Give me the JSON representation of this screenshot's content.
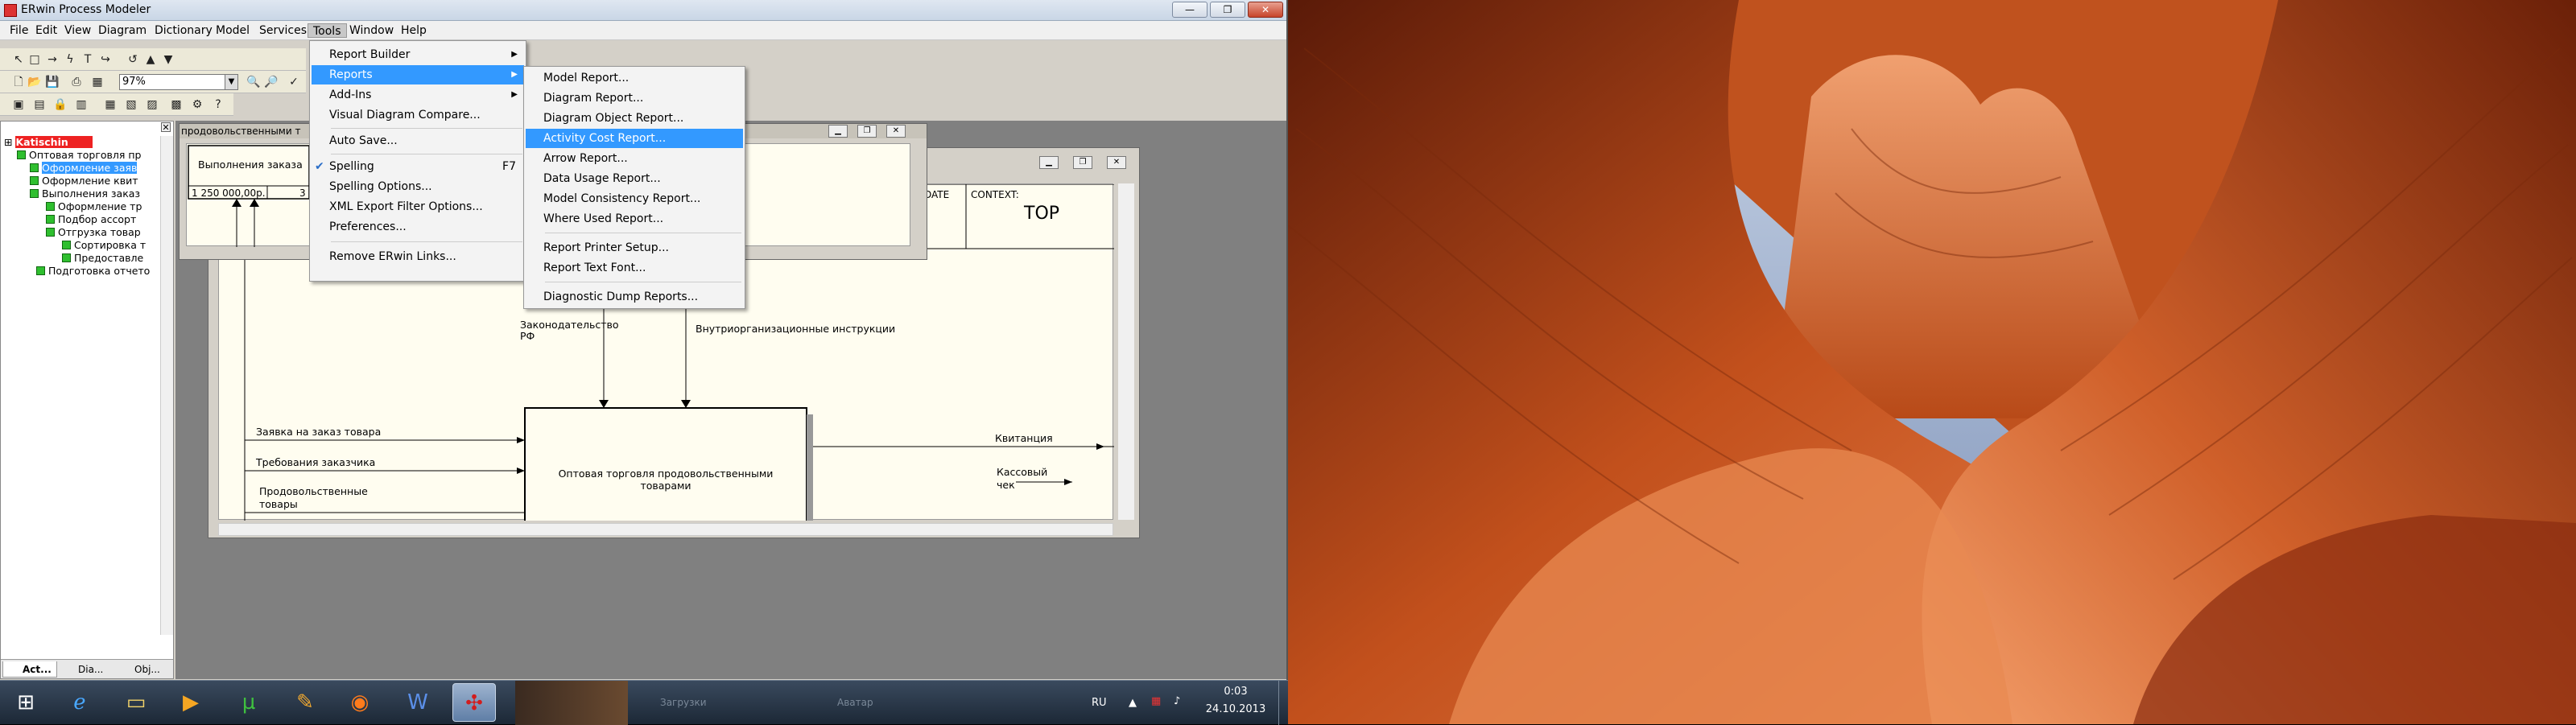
{
  "window": {
    "title": "ERwin Process Modeler",
    "controls": {
      "minimize": "—",
      "maximize": "❐",
      "close": "✕"
    }
  },
  "menubar": [
    "File",
    "Edit",
    "View",
    "Diagram",
    "Dictionary",
    "Model",
    "Services",
    "Tools",
    "Window",
    "Help"
  ],
  "toolbar": {
    "zoom": "97%"
  },
  "explorer": {
    "root": "Katischin",
    "items": [
      {
        "label": "Оптовая торговля пр",
        "indent": 1,
        "sel": false
      },
      {
        "label": "Оформление заяв",
        "indent": 2,
        "sel": true
      },
      {
        "label": "Оформление квит",
        "indent": 2,
        "sel": false
      },
      {
        "label": "Выполнения заказ",
        "indent": 2,
        "sel": false
      },
      {
        "label": "Оформление тр",
        "indent": 3,
        "sel": false
      },
      {
        "label": "Подбор ассорт",
        "indent": 3,
        "sel": false
      },
      {
        "label": "Отгрузка товар",
        "indent": 3,
        "sel": false
      },
      {
        "label": "Сортировка т",
        "indent": 4,
        "sel": false
      },
      {
        "label": "Предоставле",
        "indent": 4,
        "sel": false
      },
      {
        "label": "Подготовка отчето",
        "indent": 2,
        "sel": false
      }
    ],
    "tabs": [
      "Act...",
      "Dia...",
      "Obj..."
    ]
  },
  "front_diagram": {
    "title": "продовольственными т",
    "box_label": "Выполнения заказа",
    "cost": "1 250 000,00р.",
    "box_number": "3"
  },
  "back_diagram": {
    "header": {
      "date": "DATE",
      "context": "CONTEXT:",
      "top": "TOP"
    },
    "main_box": "Оптовая торговля продовольственными товарами",
    "arrows": {
      "law": "Законодательство РФ",
      "internal": "Внутриорганизационные инструкции",
      "order": "Заявка на заказ товара",
      "customer": "Требования заказчика",
      "food": "Продовольственные товары",
      "receipt": "Квитанция",
      "cheque": "Кассовый чек"
    }
  },
  "tools_menu": [
    {
      "label": "Report Builder",
      "sub": true
    },
    {
      "label": "Reports",
      "sub": true,
      "hi": true
    },
    {
      "label": "Add-Ins",
      "sub": true
    },
    {
      "label": "Visual Diagram Compare..."
    },
    {
      "sep": true
    },
    {
      "label": "Auto Save..."
    },
    {
      "sep": true
    },
    {
      "label": "Spelling",
      "shortcut": "F7"
    },
    {
      "label": "Spelling Options..."
    },
    {
      "label": "XML Export Filter Options..."
    },
    {
      "label": "Preferences..."
    },
    {
      "sep": true
    },
    {
      "label": "Remove ERwin Links..."
    }
  ],
  "reports_menu": [
    {
      "label": "Model Report..."
    },
    {
      "label": "Diagram Report..."
    },
    {
      "label": "Diagram Object Report..."
    },
    {
      "label": "Activity Cost Report...",
      "hi": true
    },
    {
      "label": "Arrow Report..."
    },
    {
      "label": "Data Usage Report..."
    },
    {
      "label": "Model Consistency Report..."
    },
    {
      "label": "Where Used Report..."
    },
    {
      "sep": true
    },
    {
      "label": "Report Printer Setup..."
    },
    {
      "label": "Report Text Font..."
    },
    {
      "sep": true
    },
    {
      "label": "Diagnostic Dump Reports..."
    }
  ],
  "taskbar": {
    "tray_lang": "RU",
    "time": "0:03",
    "date": "24.10.2013",
    "ghost_items": [
      "Загрузки",
      "Аватар"
    ]
  },
  "colors": {
    "highlight": "#3399ff",
    "tree_green": "#2fbf2f",
    "root_red": "#ee2222"
  }
}
